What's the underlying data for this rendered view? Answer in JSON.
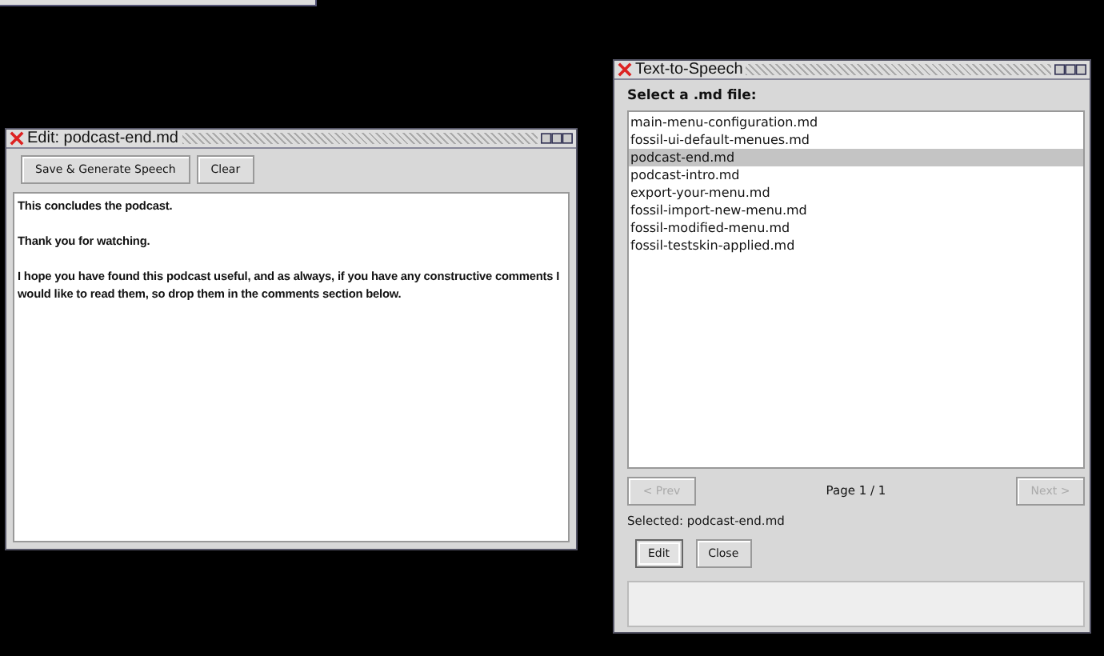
{
  "editor": {
    "title": "Edit: podcast-end.md",
    "buttons": [
      "Save & Generate Speech",
      "Clear"
    ],
    "paragraphs": [
      "This concludes the podcast.",
      "Thank you for watching.",
      "I hope you have found this podcast useful, and as always, if you have any constructive comments I would like to read them, so drop them in the comments section below."
    ]
  },
  "tts": {
    "title": "Text-to-Speech",
    "label": "Select a .md file:",
    "files": [
      {
        "name": "main-menu-configuration.md",
        "selected": false
      },
      {
        "name": "fossil-ui-default-menues.md",
        "selected": false
      },
      {
        "name": "podcast-end.md",
        "selected": true
      },
      {
        "name": "podcast-intro.md",
        "selected": false
      },
      {
        "name": "export-your-menu.md",
        "selected": false
      },
      {
        "name": "fossil-import-new-menu.md",
        "selected": false
      },
      {
        "name": "fossil-modified-menu.md",
        "selected": false
      },
      {
        "name": "fossil-testskin-applied.md",
        "selected": false
      }
    ],
    "prev": {
      "label": "< Prev",
      "disabled": true
    },
    "page": "Page 1 / 1",
    "next": {
      "label": "Next >",
      "disabled": true
    },
    "selected_text": "Selected: podcast-end.md",
    "buttons": [
      {
        "label": "Edit",
        "focused": true
      },
      {
        "label": "Close",
        "focused": false
      }
    ]
  }
}
